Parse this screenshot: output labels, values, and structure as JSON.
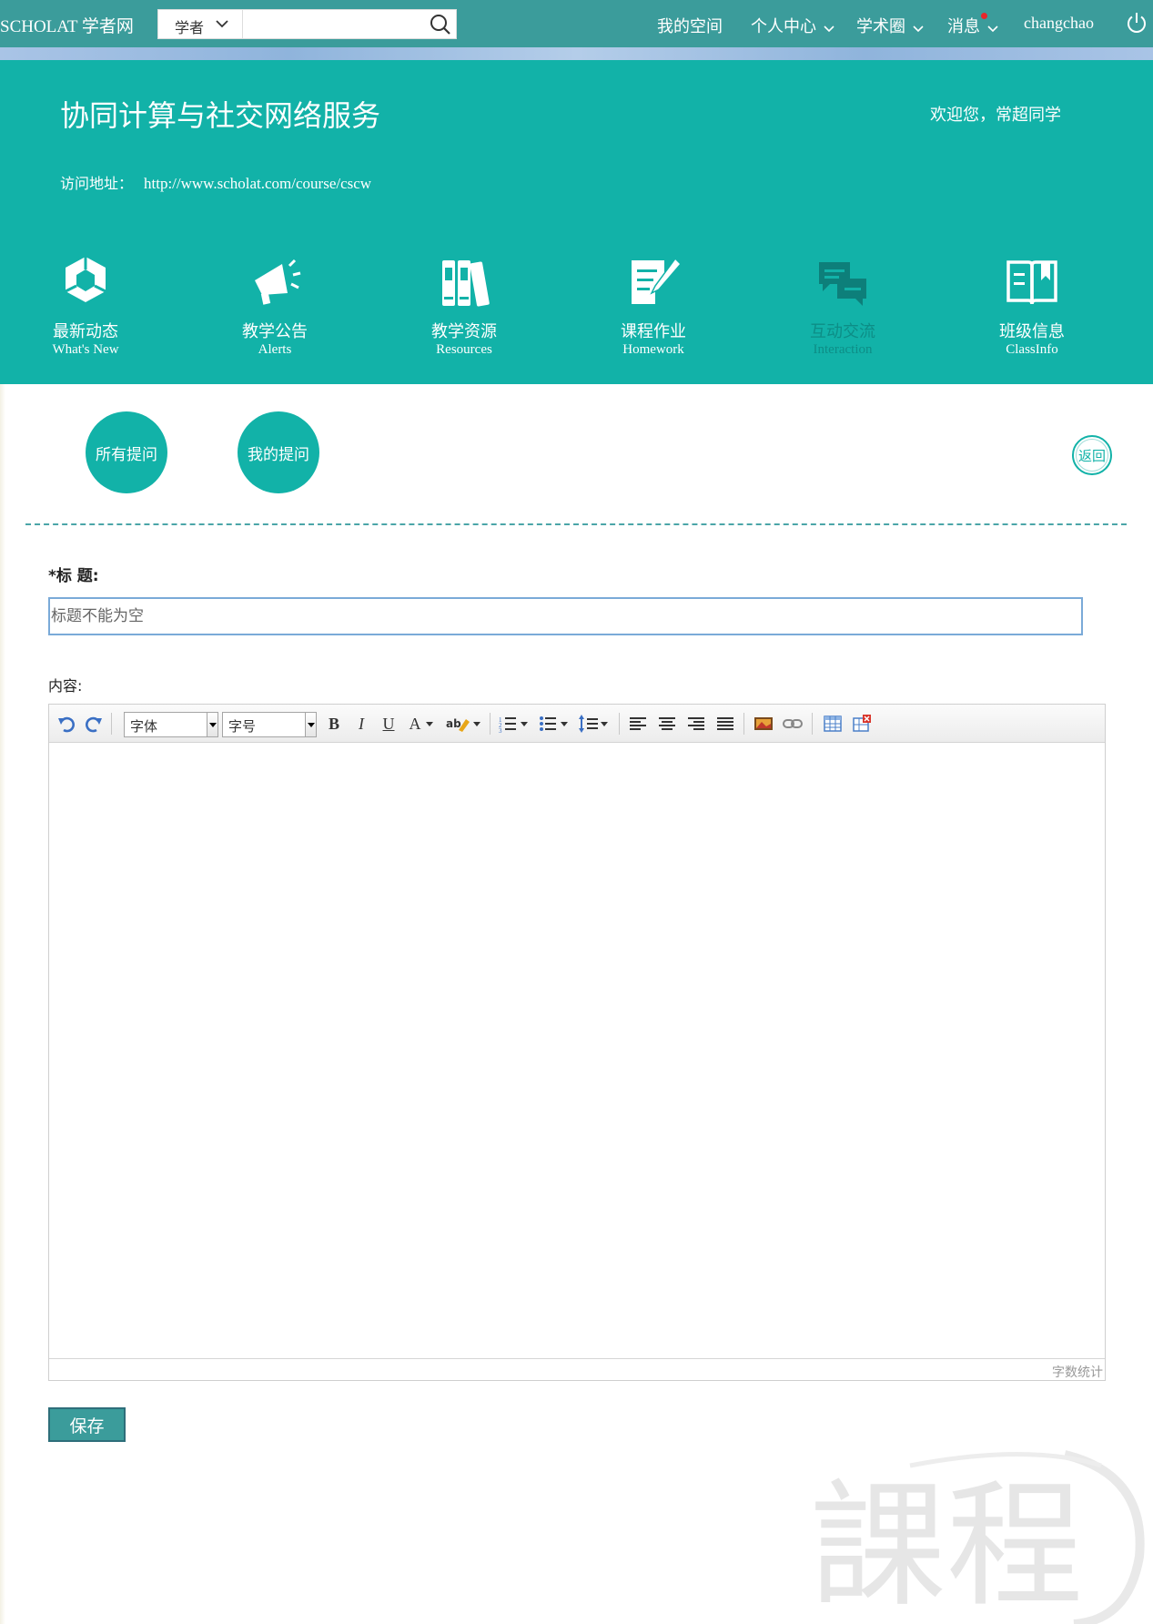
{
  "topbar": {
    "logo": "SCHOLAT 学者网",
    "search_type": "学者",
    "search_placeholder": "",
    "nav": [
      "我的空间",
      "个人中心",
      "学术圈",
      "消息",
      "changchao"
    ]
  },
  "banner": {
    "title": "协同计算与社交网络服务",
    "welcome": "欢迎您，常超同学",
    "address_label": "访问地址：",
    "address_url": "http://www.scholat.com/course/cscw",
    "modules": [
      {
        "zh": "最新动态",
        "en": "What's New",
        "icon": "cube-icon"
      },
      {
        "zh": "教学公告",
        "en": "Alerts",
        "icon": "megaphone-icon"
      },
      {
        "zh": "教学资源",
        "en": "Resources",
        "icon": "books-icon"
      },
      {
        "zh": "课程作业",
        "en": "Homework",
        "icon": "homework-icon"
      },
      {
        "zh": "互动交流",
        "en": "Interaction",
        "icon": "chat-icon"
      },
      {
        "zh": "班级信息",
        "en": "ClassInfo",
        "icon": "book-icon"
      }
    ]
  },
  "tabs": {
    "all_questions": "所有提问",
    "my_questions": "我的提问",
    "back": "返回"
  },
  "form": {
    "title_label": "*标 题:",
    "title_placeholder": "标题不能为空",
    "content_label": "内容:",
    "font_select": "字体",
    "size_select": "字号",
    "bold": "B",
    "italic": "I",
    "underline": "U",
    "font_color": "A",
    "word_count": "字数统计",
    "save": "保存"
  },
  "watermark": "課程",
  "colors": {
    "topbar": "#3b9c9b",
    "banner": "#12b2a8",
    "accent": "#12b2a8"
  }
}
